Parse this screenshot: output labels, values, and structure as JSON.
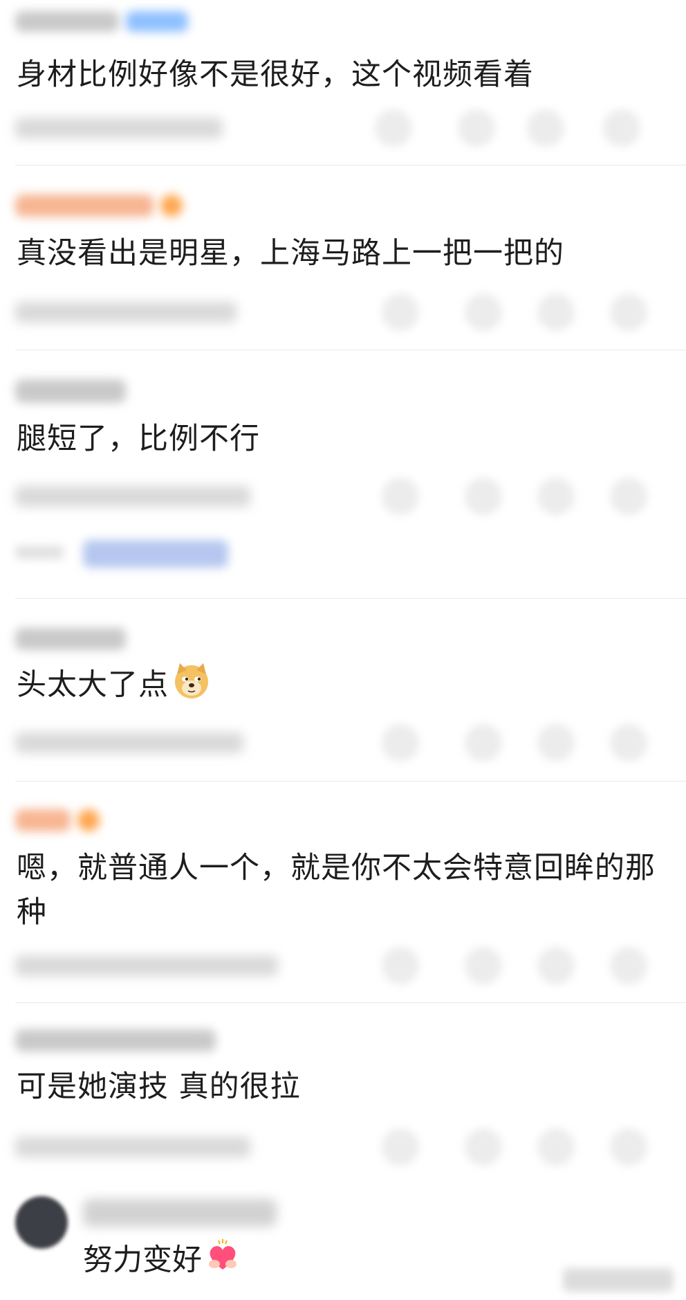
{
  "comments": [
    {
      "text": "身材比例好像不是很好，这个视频看着"
    },
    {
      "text": "真没看出是明星，上海马路上一把一把的"
    },
    {
      "text": "腿短了，比例不行"
    },
    {
      "text": "头太大了点"
    },
    {
      "text": "嗯，就普通人一个，就是你不太会特意回眸的那种"
    },
    {
      "text": "可是她演技 真的很拉"
    }
  ],
  "reply": {
    "text": "努力变好"
  },
  "icons": {
    "comment_icon": "comment-bubble-icon",
    "share_icon": "share-icon",
    "repost_icon": "repost-icon",
    "like_icon": "thumbs-up-icon",
    "doge_emoji": "doge-emoji-icon",
    "heart_emoji": "heart-hands-emoji-icon"
  },
  "colors": {
    "text": "#1d1d1d",
    "divider": "#e9e9e9",
    "vip_name": "#f7b592",
    "badge_blue": "#8ec0ff",
    "badge_orange": "#ffa54d",
    "reply_link": "#b5c7ef"
  }
}
